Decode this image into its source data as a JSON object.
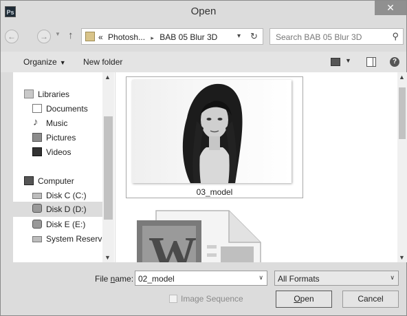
{
  "window": {
    "title": "Open",
    "app_icon_text": "Ps",
    "close_glyph": "✕"
  },
  "address_bar": {
    "overflow": "«",
    "crumbs": [
      "Photosh...",
      "BAB 05 Blur 3D"
    ],
    "crumb_separator": "▸"
  },
  "search": {
    "placeholder": "Search BAB 05 Blur 3D"
  },
  "toolbar": {
    "organize_label": "Organize",
    "new_folder_label": "New folder"
  },
  "nav_pane": {
    "libraries_label": "Libraries",
    "library_items": [
      "Documents",
      "Music",
      "Pictures",
      "Videos"
    ],
    "computer_label": "Computer",
    "drives": [
      "Disk C (C:)",
      "Disk D (D:)",
      "Disk E (E:)",
      "System Reserved"
    ],
    "selected": "Disk D (D:)"
  },
  "files": [
    {
      "name": "03_model",
      "type": "image"
    },
    {
      "name": "",
      "type": "word-document"
    }
  ],
  "bottom": {
    "file_name_label_prefix": "File ",
    "file_name_label_access_key": "n",
    "file_name_label_suffix": "ame:",
    "file_name_value": "02_model",
    "format_value": "All Formats",
    "image_sequence_label": "Image Sequence",
    "open_access_key": "O",
    "open_label_rest": "pen",
    "cancel_label": "Cancel"
  },
  "colors": {
    "chrome": "#dcdcdc",
    "selected_row": "#dcdcdc",
    "close_button": "#909090"
  }
}
